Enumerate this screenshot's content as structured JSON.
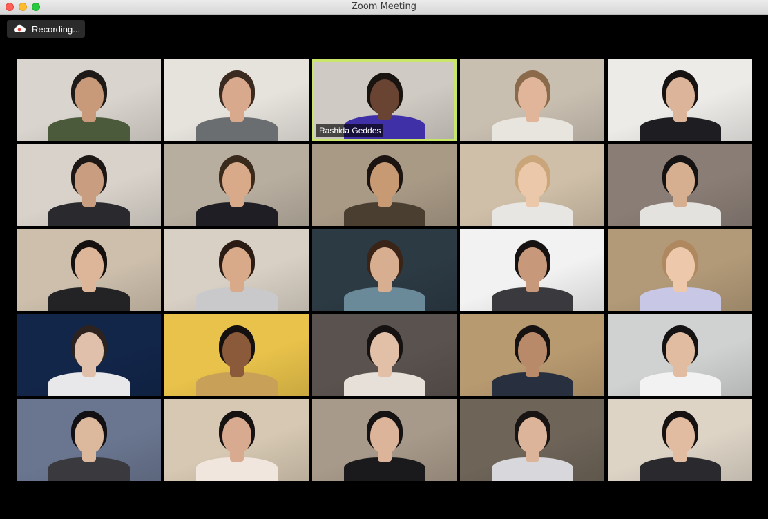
{
  "window": {
    "title": "Zoom Meeting"
  },
  "recording": {
    "label": "Recording..."
  },
  "active_speaker": {
    "name": "Rashida Geddes"
  },
  "colors": {
    "active_border": "#c9e56a",
    "record_icon": "#e0443e"
  },
  "participants": [
    {
      "bg": "#d9d4cd",
      "skin": "#c89a7a",
      "hair": "#1e1a18",
      "shirt": "#4b5a3a"
    },
    {
      "bg": "#e6e2dc",
      "skin": "#d8a98c",
      "hair": "#3a2a20",
      "shirt": "#6b6e70"
    },
    {
      "bg": "#cfcac3",
      "skin": "#6a4432",
      "hair": "#1a1410",
      "shirt": "#4030a8"
    },
    {
      "bg": "#c9bfb1",
      "skin": "#e0b59a",
      "hair": "#8a6a4a",
      "shirt": "#e8e4de"
    },
    {
      "bg": "#ecebe8",
      "skin": "#dcb49a",
      "hair": "#161212",
      "shirt": "#1d1d22"
    },
    {
      "bg": "#d8d2ca",
      "skin": "#c99e80",
      "hair": "#1c1614",
      "shirt": "#2a2a2e"
    },
    {
      "bg": "#b8aea0",
      "skin": "#d8aa8a",
      "hair": "#3a2a1c",
      "shirt": "#1e1e24"
    },
    {
      "bg": "#a99a86",
      "skin": "#c89a74",
      "hair": "#1c1410",
      "shirt": "#4a3e30"
    },
    {
      "bg": "#cfbfa8",
      "skin": "#ecc8aa",
      "hair": "#caa57a",
      "shirt": "#e8e6e2"
    },
    {
      "bg": "#8a7d76",
      "skin": "#d6ae90",
      "hair": "#141212",
      "shirt": "#e4e2de"
    },
    {
      "bg": "#cdbfac",
      "skin": "#ddb69a",
      "hair": "#141010",
      "shirt": "#232326"
    },
    {
      "bg": "#d8d0c4",
      "skin": "#d8aa8a",
      "hair": "#2a1c14",
      "shirt": "#c9c9cc"
    },
    {
      "bg": "#2c3a44",
      "skin": "#d8ae90",
      "hair": "#3a2418",
      "shirt": "#6a8a9a"
    },
    {
      "bg": "#f2f2f2",
      "skin": "#c8987a",
      "hair": "#161212",
      "shirt": "#3a3a3e"
    },
    {
      "bg": "#b29a78",
      "skin": "#eec8aa",
      "hair": "#b08860",
      "shirt": "#c8c8e6"
    },
    {
      "bg": "#12264a",
      "skin": "#e0c0aa",
      "hair": "#2c2220",
      "shirt": "#e8e8ea"
    },
    {
      "bg": "#e8c24a",
      "skin": "#8a5a3a",
      "hair": "#141010",
      "shirt": "#c8a058"
    },
    {
      "bg": "#5a524e",
      "skin": "#e2c0a8",
      "hair": "#161212",
      "shirt": "#e6e0d8"
    },
    {
      "bg": "#b89a70",
      "skin": "#b88a6a",
      "hair": "#161212",
      "shirt": "#283040"
    },
    {
      "bg": "#cfd2d0",
      "skin": "#e2bca0",
      "hair": "#141212",
      "shirt": "#f2f2f2"
    },
    {
      "bg": "#6a7690",
      "skin": "#dcb89c",
      "hair": "#121012",
      "shirt": "#3a3a3e"
    },
    {
      "bg": "#d6c8b2",
      "skin": "#d8aa90",
      "hair": "#161212",
      "shirt": "#f0e6de"
    },
    {
      "bg": "#a89a8a",
      "skin": "#dcb49a",
      "hair": "#141212",
      "shirt": "#1a1a1c"
    },
    {
      "bg": "#6e6458",
      "skin": "#dcb49a",
      "hair": "#181414",
      "shirt": "#d8d8dc"
    },
    {
      "bg": "#ddd4c6",
      "skin": "#e2bca0",
      "hair": "#161212",
      "shirt": "#2a2a2e"
    }
  ]
}
